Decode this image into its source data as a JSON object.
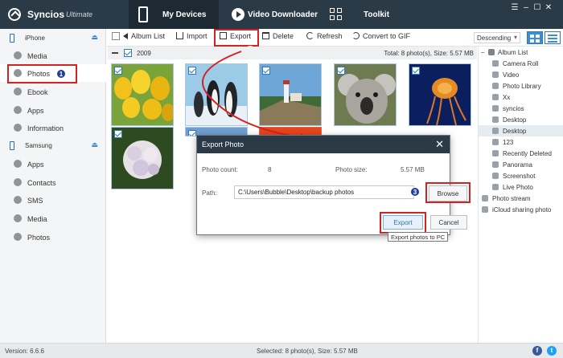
{
  "app": {
    "name": "Syncios",
    "edition": "Ultimate"
  },
  "tabs": [
    {
      "label": "My Devices",
      "active": true
    },
    {
      "label": "Video Downloader",
      "active": false
    },
    {
      "label": "Toolkit",
      "active": false
    }
  ],
  "window_controls": [
    "menu-icon",
    "minimize-icon",
    "maximize-icon",
    "close-icon"
  ],
  "sidebar": {
    "devices": [
      {
        "name": "iPhone",
        "items": [
          "Media",
          "Photos",
          "Ebook",
          "Apps",
          "Information"
        ]
      },
      {
        "name": "Samsung",
        "items": [
          "Apps",
          "Contacts",
          "SMS",
          "Media",
          "Photos"
        ]
      }
    ],
    "active_item": "Photos"
  },
  "toolbar": {
    "album_list": "Album List",
    "import": "Import",
    "export": "Export",
    "delete": "Delete",
    "refresh": "Refresh",
    "convert": "Convert to GIF",
    "sort_value": "Descending"
  },
  "group": {
    "year": "2009",
    "total": "Total: 8 photo(s), Size: 5.57 MB"
  },
  "albums": {
    "header": "Album List",
    "items": [
      "Camera Roll",
      "Video",
      "Photo Library",
      "Xx",
      "syncios",
      "Desktop",
      "Desktop",
      "123",
      "Recently Deleted",
      "Panorama",
      "Screenshot",
      "Live Photo"
    ],
    "selected": "Desktop",
    "extra": [
      "Photo stream",
      "iCloud sharing photo"
    ]
  },
  "dialog": {
    "title": "Export Photo",
    "photo_count_label": "Photo count:",
    "photo_count_value": "8",
    "photo_size_label": "Photo size:",
    "photo_size_value": "5.57 MB",
    "path_label": "Path:",
    "path_value": "C:\\Users\\Bubble\\Desktop\\backup photos",
    "browse": "Browse",
    "export": "Export",
    "cancel": "Cancel",
    "tooltip": "Export photos to PC"
  },
  "steps": [
    "1",
    "2",
    "3"
  ],
  "status": {
    "version": "Version: 6.6.6",
    "selected": "Selected: 8 photo(s), Size: 5.57 MB"
  },
  "social": {
    "facebook": "f",
    "twitter": "t"
  },
  "colors": {
    "titlebar": "#2b3a47",
    "accent": "#3b8ed6",
    "highlight_box": "#d32222",
    "step_badge": "#1e3f99"
  }
}
